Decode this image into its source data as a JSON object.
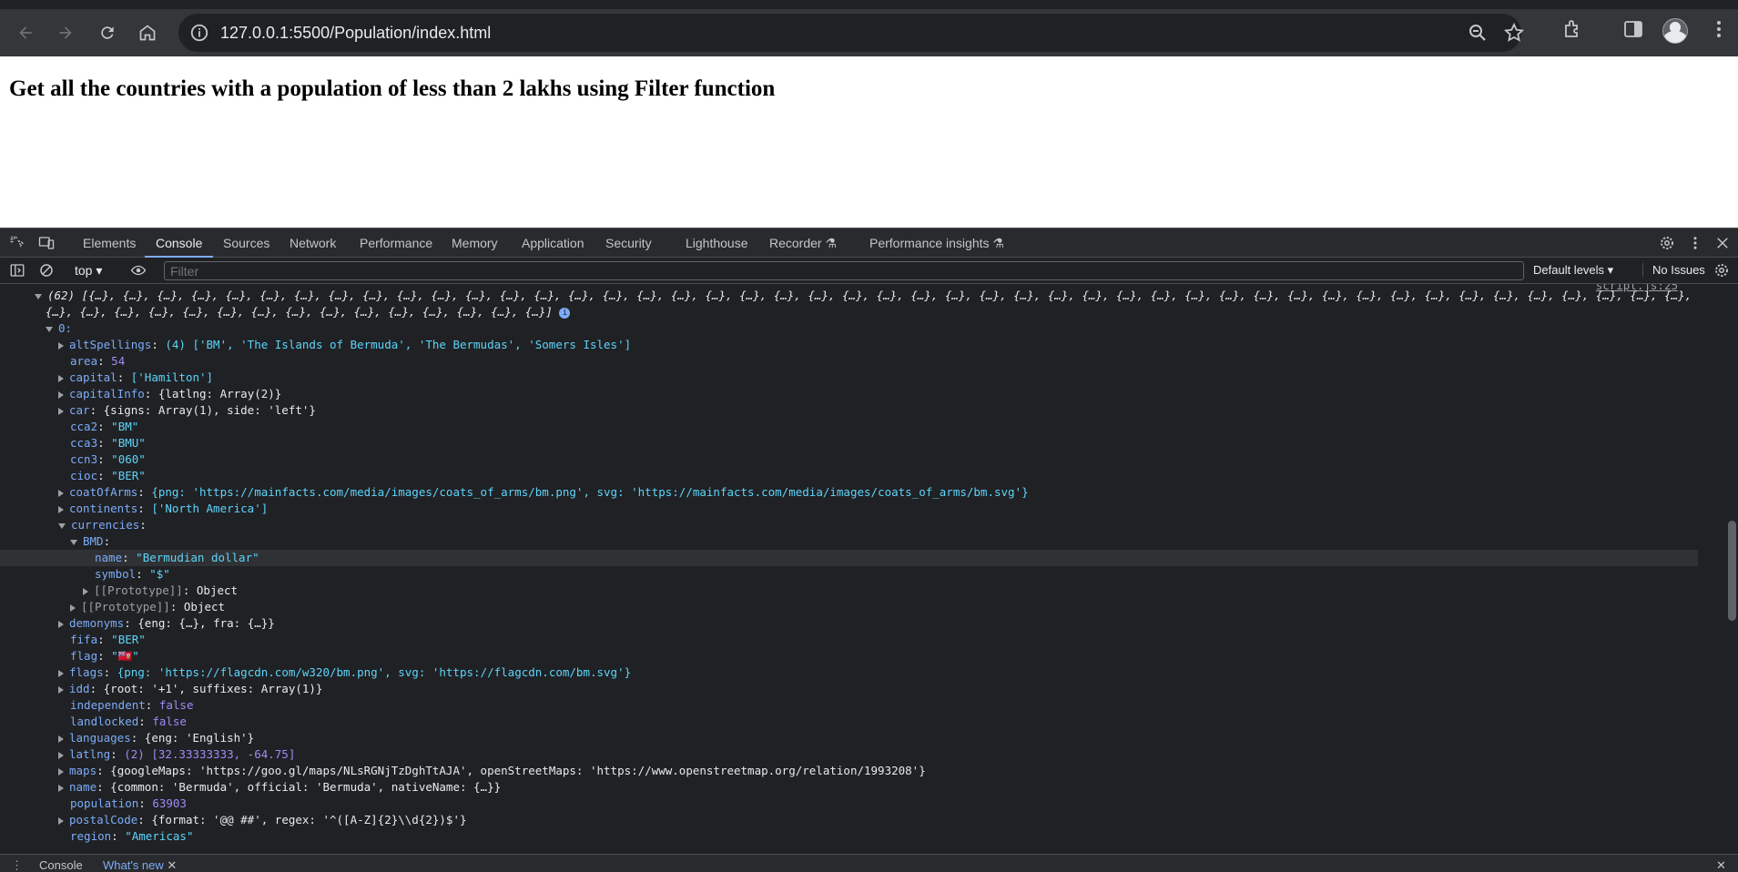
{
  "browser": {
    "url": "127.0.0.1:5500/Population/index.html"
  },
  "page": {
    "heading": "Get all the countries with a population of less than 2 lakhs using Filter function"
  },
  "devtools": {
    "tabs": [
      "Elements",
      "Console",
      "Sources",
      "Network",
      "Performance",
      "Memory",
      "Application",
      "Security",
      "Lighthouse",
      "Recorder",
      "Performance insights"
    ],
    "active_tab": "Console",
    "context": "top",
    "filter_placeholder": "Filter",
    "default_levels": "Default levels",
    "issues": "No Issues",
    "source_link": "script.js:25",
    "drawer_tabs": [
      "Console",
      "What's new"
    ]
  },
  "console": {
    "summary_line_1": "(62) [{…}, {…}, {…}, {…}, {…}, {…}, {…}, {…}, {…}, {…}, {…}, {…}, {…}, {…}, {…}, {…}, {…}, {…}, {…}, {…}, {…}, {…}, {…}, {…}, {…}, {…}, {…}, {…}, {…}, {…}, {…}, {…}, {…}, {…}, {…}, {…}, {…}, {…}, {…}, {…}, {…}, {…}, {…}, {…}, {…}, {…}, {…},",
    "summary_line_2": "{…}, {…}, {…}, {…}, {…}, {…}, {…}, {…}, {…}, {…}, {…}, {…}, {…}, {…}, {…}]",
    "index_label": "0:",
    "entries": [
      {
        "key": "altSpellings",
        "value": "(4) ['BM', 'The Islands of Bermuda', 'The Bermudas', 'Somers Isles']"
      },
      {
        "key": "area",
        "value": "54"
      },
      {
        "key": "capital",
        "value": "['Hamilton']"
      },
      {
        "key": "capitalInfo",
        "value": "{latlng: Array(2)}"
      },
      {
        "key": "car",
        "value": "{signs: Array(1), side: 'left'}"
      },
      {
        "key": "cca2",
        "value": "\"BM\""
      },
      {
        "key": "cca3",
        "value": "\"BMU\""
      },
      {
        "key": "ccn3",
        "value": "\"060\""
      },
      {
        "key": "cioc",
        "value": "\"BER\""
      },
      {
        "key": "coatOfArms",
        "value": "{png: 'https://mainfacts.com/media/images/coats_of_arms/bm.png', svg: 'https://mainfacts.com/media/images/coats_of_arms/bm.svg'}"
      },
      {
        "key": "continents",
        "value": "['North America']"
      },
      {
        "key": "currencies",
        "value": ""
      },
      {
        "key": "BMD",
        "value": ""
      },
      {
        "key": "name",
        "value": "\"Bermudian dollar\""
      },
      {
        "key": "symbol",
        "value": "\"$\""
      },
      {
        "key": "[[Prototype]]",
        "value": "Object"
      },
      {
        "key": "[[Prototype]]",
        "value": "Object"
      },
      {
        "key": "demonyms",
        "value": "{eng: {…}, fra: {…}}"
      },
      {
        "key": "fifa",
        "value": "\"BER\""
      },
      {
        "key": "flag",
        "value": "\"🇧🇲\""
      },
      {
        "key": "flags",
        "value": "{png: 'https://flagcdn.com/w320/bm.png', svg: 'https://flagcdn.com/bm.svg'}"
      },
      {
        "key": "idd",
        "value": "{root: '+1', suffixes: Array(1)}"
      },
      {
        "key": "independent",
        "value": "false"
      },
      {
        "key": "landlocked",
        "value": "false"
      },
      {
        "key": "languages",
        "value": "{eng: 'English'}"
      },
      {
        "key": "latlng",
        "value": "(2) [32.33333333, -64.75]"
      },
      {
        "key": "maps",
        "value": "{googleMaps: 'https://goo.gl/maps/NLsRGNjTzDghTtAJA', openStreetMaps: 'https://www.openstreetmap.org/relation/1993208'}"
      },
      {
        "key": "name",
        "value": "{common: 'Bermuda', official: 'Bermuda', nativeName: {…}}"
      },
      {
        "key": "population",
        "value": "63903"
      },
      {
        "key": "postalCode",
        "value": "{format: '@@ ##', regex: '^([A-Z]{2}\\\\d{2})$'}"
      },
      {
        "key": "region",
        "value": "\"Americas\""
      }
    ]
  },
  "colors": {
    "accent": "#7cacf8",
    "key": "#7cacf8",
    "string": "#5cd5fb",
    "number": "#9e8cf7"
  }
}
